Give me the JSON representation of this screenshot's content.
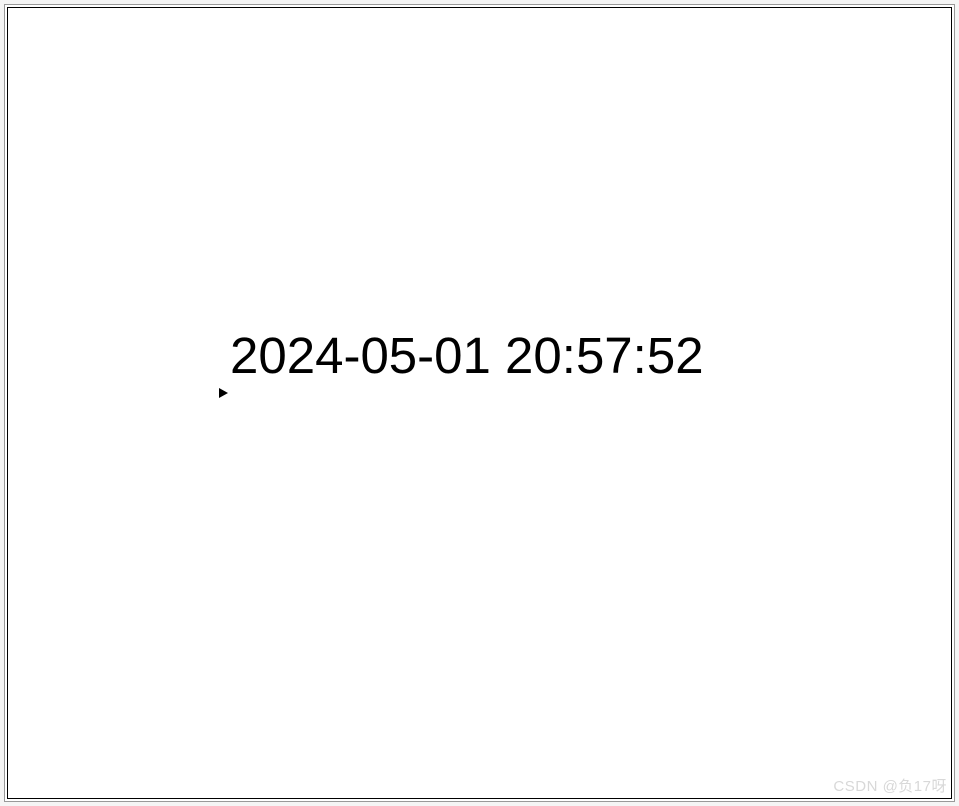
{
  "datetime": "2024-05-01 20:57:52",
  "watermark": "CSDN @负17呀"
}
